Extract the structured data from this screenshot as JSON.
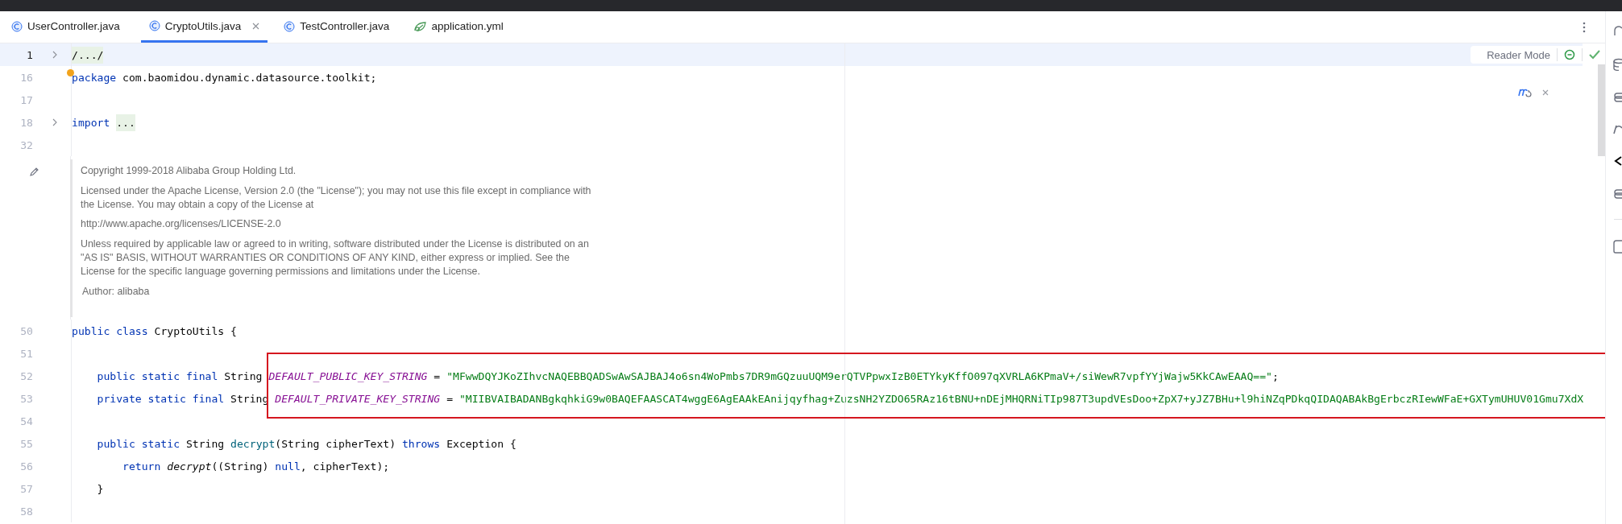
{
  "tabs": [
    {
      "label": "UserController.java",
      "kind": "java",
      "selected": false
    },
    {
      "label": "CryptoUtils.java",
      "kind": "java",
      "selected": true
    },
    {
      "label": "TestController.java",
      "kind": "java",
      "selected": false
    },
    {
      "label": "application.yml",
      "kind": "yaml",
      "selected": false
    }
  ],
  "reader_mode": {
    "label": "Reader Mode"
  },
  "editor": [
    {
      "kind": "line",
      "number": "1",
      "current": true,
      "fold": true,
      "tokens": [
        {
          "text": "/.../",
          "kind": "folded"
        }
      ]
    },
    {
      "kind": "line",
      "number": "16",
      "current": false,
      "fold": false,
      "hint_dot": true,
      "tokens": [
        {
          "text": "package",
          "kind": "keyword"
        },
        {
          "text": " com.baomidou.dynamic.datasource.toolkit;",
          "kind": "plain"
        }
      ]
    },
    {
      "kind": "line",
      "number": "17",
      "current": false,
      "fold": false
    },
    {
      "kind": "line",
      "number": "18",
      "current": false,
      "fold": true,
      "tokens": [
        {
          "text": "import",
          "kind": "keyword"
        },
        {
          "text": "...",
          "kind": "folded"
        }
      ]
    },
    {
      "kind": "line",
      "number": "32",
      "current": false,
      "fold": false
    },
    {
      "kind": "doc_comment",
      "paragraphs": [
        "Copyright 1999-2018 Alibaba Group Holding Ltd.",
        "Licensed under the Apache License, Version 2.0 (the \"License\"); you may not use this file except in compliance with the License. You may obtain a copy of the License at",
        "http://www.apache.org/licenses/LICENSE-2.0",
        "Unless required by applicable law or agreed to in writing, software distributed under the License is distributed on an \"AS IS\" BASIS, WITHOUT WARRANTIES OR CONDITIONS OF ANY KIND, either express or implied. See the License for the specific language governing permissions and limitations under the License."
      ],
      "author": "Author: alibaba"
    },
    {
      "kind": "line",
      "number": "50",
      "current": false,
      "fold": false,
      "tokens": [
        {
          "text": "public class",
          "kind": "keyword"
        },
        {
          "text": " CryptoUtils {",
          "kind": "plain"
        }
      ]
    },
    {
      "kind": "line",
      "number": "51",
      "current": false,
      "fold": false
    },
    {
      "kind": "line",
      "number": "52",
      "current": false,
      "fold": false,
      "tokens": [
        {
          "text": "    public static final",
          "kind": "keyword"
        },
        {
          "text": " String ",
          "kind": "plain"
        },
        {
          "text": "DEFAULT_PUBLIC_KEY_STRING",
          "kind": "constant"
        },
        {
          "text": " = ",
          "kind": "plain"
        },
        {
          "text": "\"MFwwDQYJKoZIhvcNAQEBBQADSwAwSAJBAJ4o6sn4WoPmbs7DR9mGQzuuUQM9erQTVPpwxIzB0ETYkyKffO097qXVRLA6KPmaV+/siWewR7vpfYYjWajw5KkCAwEAAQ==\"",
          "kind": "string"
        },
        {
          "text": ";",
          "kind": "plain"
        }
      ]
    },
    {
      "kind": "line",
      "number": "53",
      "current": false,
      "fold": false,
      "tokens": [
        {
          "text": "    private static final",
          "kind": "keyword"
        },
        {
          "text": " String ",
          "kind": "plain"
        },
        {
          "text": "DEFAULT_PRIVATE_KEY_STRING",
          "kind": "constant"
        },
        {
          "text": " = ",
          "kind": "plain"
        },
        {
          "text": "\"MIIBVAIBADANBgkqhkiG9w0BAQEFAASCAT4wggE6AgEAAkEAnijqyfhag+ZuzsNH2YZDO65RAz16tBNU+nDEjMHQRNiTIp987T3updVEsDoo+ZpX7+yJZ7BHu+l9hiNZqPDkqQIDAQABAkBgErbczRIewWFaE+GXTymUHUV01Gmu7XdX",
          "kind": "string"
        }
      ]
    },
    {
      "kind": "line",
      "number": "54",
      "current": false,
      "fold": false
    },
    {
      "kind": "line",
      "number": "55",
      "current": false,
      "fold": false,
      "tokens": [
        {
          "text": "    public static",
          "kind": "keyword"
        },
        {
          "text": " String ",
          "kind": "plain"
        },
        {
          "text": "decrypt",
          "kind": "method"
        },
        {
          "text": "(String cipherText) ",
          "kind": "plain"
        },
        {
          "text": "throws",
          "kind": "keyword"
        },
        {
          "text": " Exception {",
          "kind": "plain"
        }
      ]
    },
    {
      "kind": "line",
      "number": "56",
      "current": false,
      "fold": false,
      "tokens": [
        {
          "text": "        return ",
          "kind": "keyword"
        },
        {
          "text": "decrypt",
          "kind": "call"
        },
        {
          "text": "((String) ",
          "kind": "plain"
        },
        {
          "text": "null",
          "kind": "keyword"
        },
        {
          "text": ", cipherText);",
          "kind": "plain"
        }
      ]
    },
    {
      "kind": "line",
      "number": "57",
      "current": false,
      "fold": false,
      "tokens": [
        {
          "text": "    }",
          "kind": "plain"
        }
      ]
    },
    {
      "kind": "line",
      "number": "58",
      "current": false,
      "fold": false
    }
  ]
}
